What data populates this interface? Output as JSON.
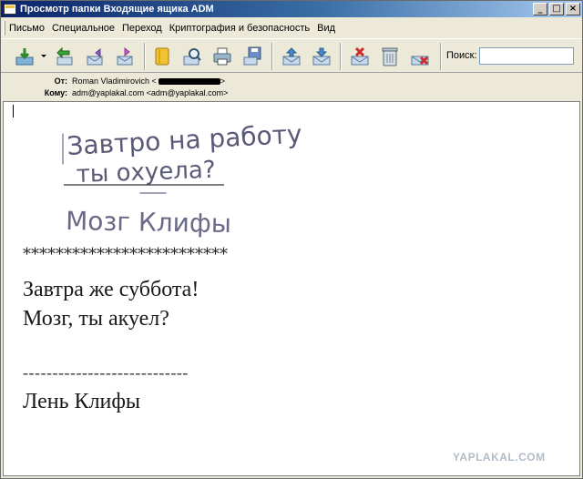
{
  "window": {
    "title": "Просмотр папки Входящие ящика ADM",
    "controls": [
      "_",
      "□",
      "×"
    ]
  },
  "menu": [
    {
      "label": "Письмо"
    },
    {
      "label": "Специальное"
    },
    {
      "label": "Переход"
    },
    {
      "label": "Криптография и безопасность"
    },
    {
      "label": "Вид"
    }
  ],
  "toolbar": {
    "buttons": [
      "get-mail-icon",
      "reply-icon",
      "reply-all-icon",
      "forward-icon",
      "redirect-icon",
      "address-book-icon",
      "find-icon",
      "print-icon",
      "save-icon",
      "previous-icon",
      "next-icon",
      "mark-delete-icon",
      "trash-icon",
      "delete-icon"
    ],
    "search_label": "Поиск:",
    "search_value": ""
  },
  "headers": {
    "from_label": "От:",
    "from_value": "Roman Vladimirovich <",
    "from_suffix": ">",
    "to_label": "Кому:",
    "to_value": "adm@yaplakal.com <adm@yaplakal.com>"
  },
  "body": {
    "handwriting_line1": "Завтро на работу",
    "handwriting_line2": "ты охуела?",
    "handwriting_signature": "Мозг Клифы",
    "stars": "*************************",
    "line1": "Завтра же суббота!",
    "line2": "Мозг, ты акуел?",
    "dashes": "----------------------------",
    "signature": "Лень Клифы",
    "watermark": "YAPLAKAL.COM"
  },
  "colors": {
    "titlebar_start": "#0a246a",
    "titlebar_end": "#a6caf0",
    "chrome": "#ece9d8"
  }
}
